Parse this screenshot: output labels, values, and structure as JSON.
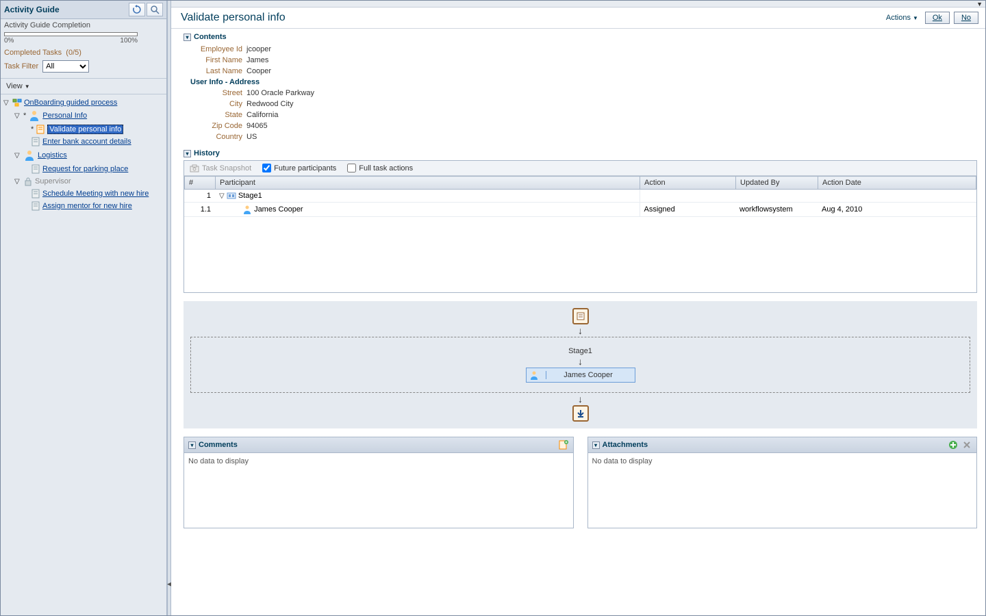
{
  "sidebar": {
    "title": "Activity Guide",
    "completion_label": "Activity Guide Completion",
    "progress_min": "0%",
    "progress_max": "100%",
    "completed_tasks_label": "Completed Tasks",
    "completed_tasks_value": "(0/5)",
    "task_filter_label": "Task Filter",
    "task_filter_value": "All",
    "view_label": "View",
    "tree": {
      "root": "OnBoarding guided process",
      "personal_info": "Personal Info",
      "validate_personal_info": "Validate personal info",
      "enter_bank": "Enter bank account details",
      "logistics": "Logistics",
      "parking": "Request for parking place",
      "supervisor": "Supervisor",
      "schedule_meeting": "Schedule Meeting with new hire",
      "assign_mentor": "Assign mentor for new hire"
    }
  },
  "main": {
    "title": "Validate personal info",
    "actions_label": "Actions",
    "ok_label": "Ok",
    "no_label": "No"
  },
  "contents": {
    "heading": "Contents",
    "employee_id_label": "Employee Id",
    "employee_id": "jcooper",
    "first_name_label": "First Name",
    "first_name": "James",
    "last_name_label": "Last Name",
    "last_name": "Cooper",
    "user_info_heading": "User Info - Address",
    "street_label": "Street",
    "street": "100 Oracle Parkway",
    "city_label": "City",
    "city": "Redwood City",
    "state_label": "State",
    "state": "California",
    "zip_label": "Zip Code",
    "zip": "94065",
    "country_label": "Country",
    "country": "US"
  },
  "history": {
    "heading": "History",
    "task_snapshot": "Task Snapshot",
    "future_participants": "Future participants",
    "full_task_actions": "Full task actions",
    "columns": {
      "num": "#",
      "participant": "Participant",
      "action": "Action",
      "updated_by": "Updated By",
      "action_date": "Action Date"
    },
    "rows": [
      {
        "num": "1",
        "participant": "Stage1",
        "action": "",
        "updated_by": "",
        "action_date": "",
        "is_group": true
      },
      {
        "num": "1.1",
        "participant": "James Cooper",
        "action": "Assigned",
        "updated_by": "workflowsystem",
        "action_date": "Aug 4, 2010",
        "is_group": false
      }
    ]
  },
  "flow": {
    "stage_label": "Stage1",
    "participant": "James Cooper"
  },
  "comments": {
    "heading": "Comments",
    "empty": "No data to display"
  },
  "attachments": {
    "heading": "Attachments",
    "empty": "No data to display"
  }
}
